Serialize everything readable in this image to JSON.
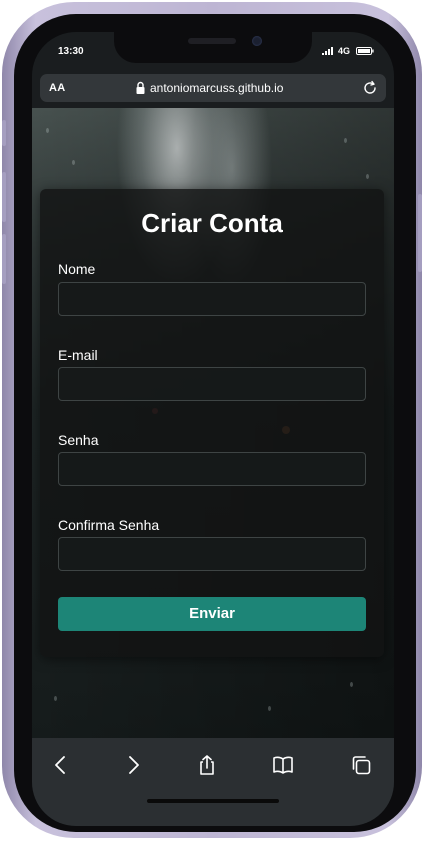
{
  "status_bar": {
    "time": "13:30",
    "network": "4G"
  },
  "browser": {
    "aa_label": "AA",
    "url": "antoniomarcuss.github.io"
  },
  "form": {
    "title": "Criar Conta",
    "fields": [
      {
        "label": "Nome",
        "value": ""
      },
      {
        "label": "E-mail",
        "value": ""
      },
      {
        "label": "Senha",
        "value": ""
      },
      {
        "label": "Confirma Senha",
        "value": ""
      }
    ],
    "submit_label": "Enviar"
  },
  "toolbar": {
    "icons": [
      "back-icon",
      "forward-icon",
      "share-icon",
      "bookmarks-icon",
      "tabs-icon"
    ]
  },
  "colors": {
    "accent": "#1d8577",
    "card": "#121414",
    "toolbar": "#2b2f32",
    "frame": "#bdb5d3"
  }
}
